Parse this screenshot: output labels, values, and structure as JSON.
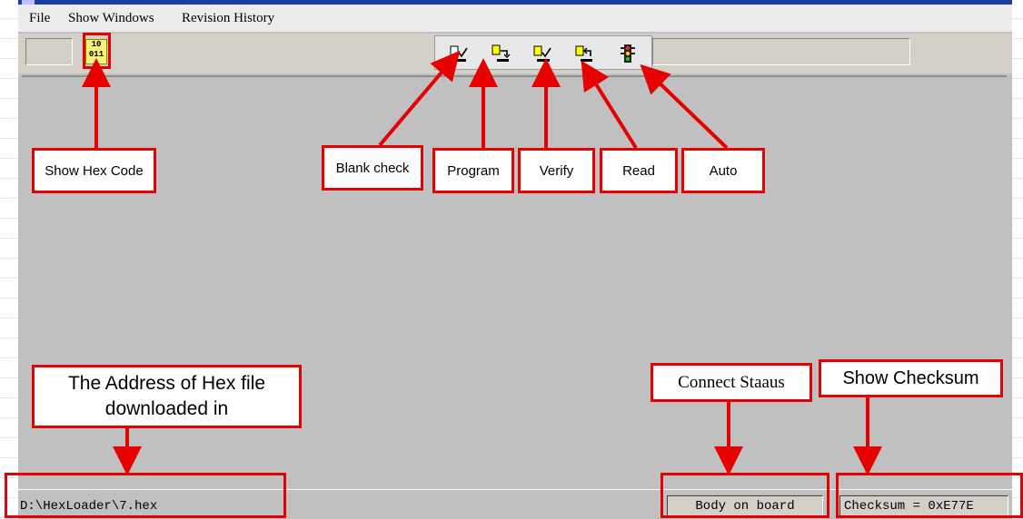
{
  "menu": {
    "file": "File",
    "show_windows": "Show Windows",
    "revision_history": "Revision History"
  },
  "toolbar": {
    "hex_icon_text": "10\n011",
    "buttons": [
      {
        "name": "blank-check",
        "icon": "blank-check-icon"
      },
      {
        "name": "program",
        "icon": "program-icon"
      },
      {
        "name": "verify",
        "icon": "verify-icon"
      },
      {
        "name": "read",
        "icon": "read-icon"
      },
      {
        "name": "auto",
        "icon": "traffic-light-icon"
      }
    ]
  },
  "callouts": {
    "show_hex_code": "Show Hex Code",
    "blank_check": "Blank check",
    "program": "Program",
    "verify": "Verify",
    "read": "Read",
    "auto": "Auto",
    "address": "The Address of Hex file downloaded in",
    "connect_status": "Connect Staaus",
    "show_checksum": "Show Checksum"
  },
  "status": {
    "path": "D:\\HexLoader\\7.hex",
    "connection": "Body on board",
    "checksum": "Checksum = 0xE77E"
  },
  "colors": {
    "annotation_red": "#e60000",
    "window_gray": "#c0c0c0",
    "hex_icon_yellow": "#f6f27a"
  }
}
